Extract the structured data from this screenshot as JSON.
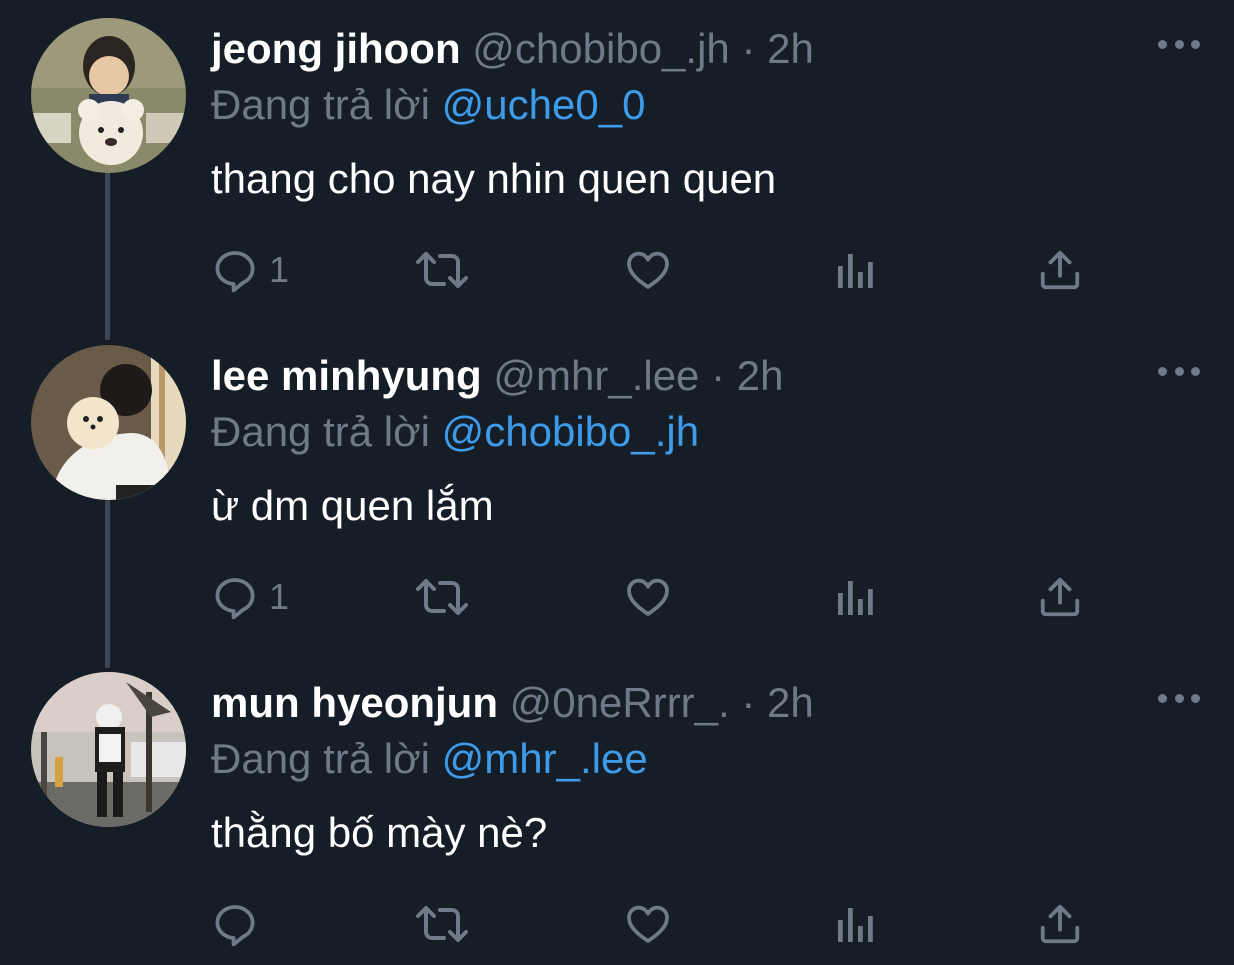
{
  "colors": {
    "background": "#151d27",
    "secondary_text": "#6e7a88",
    "mention": "#3d9be9",
    "thread_line": "#3c4654"
  },
  "tweets": [
    {
      "name": "jeong jihoon",
      "handle": "@chobibo_.jh",
      "separator": "·",
      "time": "2h",
      "reply_prefix": "Đang trả lời",
      "reply_to": "@uche0_0",
      "text": "thang cho nay nhin quen quen",
      "reply_count": "1",
      "icons": [
        "reply-icon",
        "retweet-icon",
        "like-icon",
        "stats-icon",
        "share-icon",
        "more-icon"
      ]
    },
    {
      "name": "lee minhyung",
      "handle": "@mhr_.lee",
      "separator": "·",
      "time": "2h",
      "reply_prefix": "Đang trả lời",
      "reply_to": "@chobibo_.jh",
      "text": "ừ dm quen lắm",
      "reply_count": "1",
      "icons": [
        "reply-icon",
        "retweet-icon",
        "like-icon",
        "stats-icon",
        "share-icon",
        "more-icon"
      ]
    },
    {
      "name": "mun hyeonjun",
      "handle": "@0neRrrr_.",
      "separator": "·",
      "time": "2h",
      "reply_prefix": "Đang trả lời",
      "reply_to": "@mhr_.lee",
      "text": "thằng bố mày nè?",
      "reply_count": "",
      "icons": [
        "reply-icon",
        "retweet-icon",
        "like-icon",
        "stats-icon",
        "share-icon",
        "more-icon"
      ]
    }
  ]
}
